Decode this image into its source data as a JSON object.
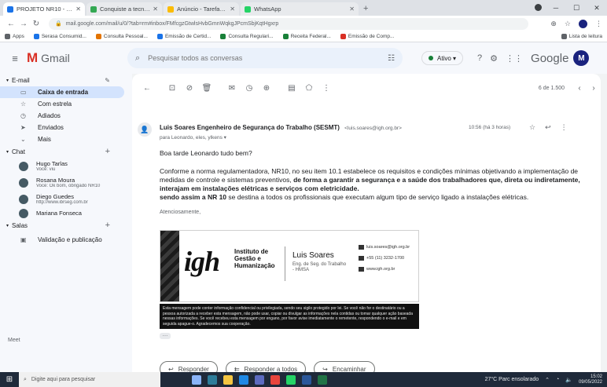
{
  "browser": {
    "tabs": [
      {
        "label": "PROJETO NR10 - MAIO",
        "color": "#1a73e8",
        "active": true
      },
      {
        "label": "Conquiste a tecnica e s...",
        "color": "#34a853",
        "active": false
      },
      {
        "label": "Anúncio - Tarefas Google",
        "color": "#fbbc04",
        "active": false
      },
      {
        "label": "WhatsApp",
        "color": "#25d366",
        "active": false
      }
    ],
    "new_tab": "+",
    "url": "mail.google.com/mail/u/0/?tab=rm#inbox/FMfcgzGtwlsHvbGmnWqkgJPcmSbjKqtHgxrp",
    "bookmarks": [
      {
        "label": "Apps",
        "color": "#5f6368"
      },
      {
        "label": "Serasa Consumid...",
        "color": "#1a73e8"
      },
      {
        "label": "Consulta Pessoal...",
        "color": "#e37400"
      },
      {
        "label": "Emissão de Certid...",
        "color": "#1a73e8"
      },
      {
        "label": "Consulta Regulari...",
        "color": "#188038"
      },
      {
        "label": "Receita Federal...",
        "color": "#188038"
      },
      {
        "label": "Emissão de Comp...",
        "color": "#d93025"
      }
    ],
    "bookmarks_right": "Lista de leitura"
  },
  "gmail": {
    "logo_text": "Gmail",
    "search_placeholder": "Pesquisar todos as conversas",
    "status": "Ativo",
    "google_word": "Google",
    "avatar_letter": "M"
  },
  "sidebar": {
    "mail_header": "E-mail",
    "items": [
      {
        "label": "Caixa de entrada",
        "icon": "▭",
        "active": true
      },
      {
        "label": "Com estrela",
        "icon": "☆",
        "active": false
      },
      {
        "label": "Adiados",
        "icon": "◷",
        "active": false
      },
      {
        "label": "Enviados",
        "icon": "➤",
        "active": false
      },
      {
        "label": "Mais",
        "icon": "⌄",
        "active": false
      }
    ],
    "chat_header": "Chat",
    "chats": [
      {
        "name": "Hugo Tarlas",
        "sub": "Você: viu"
      },
      {
        "name": "Rosana Moura",
        "sub": "Você: Ok bom, obrigado NR10"
      },
      {
        "name": "Diego Guedes",
        "sub": "http://www.ibrseg.com.br"
      },
      {
        "name": "Mariana Fonseca",
        "sub": ""
      }
    ],
    "spaces_header": "Salas",
    "spaces": [
      {
        "label": "Validação e publicação"
      }
    ],
    "more_label": "Meet"
  },
  "message": {
    "pager": "6 de 1.500",
    "sender": "Luis Soares Engenheiro de Segurança do Trabalho (SESMT)",
    "sender_email": "<luis.soares@igh.org.br>",
    "to_line": "para Leonardo, eles, ylkens ▾",
    "date": "10:56 (há 3 horas)",
    "greeting": "Boa tarde Leonardo tudo bem?",
    "para1_normal": "Conforme a norma regulamentadora, NR10, no seu item 10.1 estabelece os requisitos e condições mínimas objetivando a implementação de medidas de controle e sistemas preventivos, ",
    "para1_bold": "de forma a garantir a segurança e a saúde dos trabalhadores que, direta ou indiretamente, interajam em instalações elétricas e serviços com eletricidade.",
    "para2_bold": "sendo assim a NR 10 ",
    "para2_normal": "se destina a todos os profissionais que executam algum tipo de serviço ligado a instalações elétricas.",
    "closing": "Atenciosamente,",
    "signature": {
      "logo": "igh",
      "inst_line1": "Instituto de",
      "inst_line2": "Gestão e",
      "inst_line3": "Humanização",
      "name": "Luis Soares",
      "role": "Eng. de Seg. do Trabalho - HMSA",
      "email": "luis.soares@igh.org.br",
      "phone": "+55 (11) 3232-1700",
      "site": "www.igh.org.br"
    },
    "disclaimer": "Esta mensagem pode conter informação confidencial ou privilegiada, sendo seu sigilo protegido por lei. Se você não for o destinatário ou a pessoa autorizada a receber esta mensagem, não pode usar, copiar ou divulgar as informações nela contidas ou tomar qualquer ação baseada nessas informações. Se você recebeu esta mensagem por engano, por favor avise imediatamente o remetente, respondendo o e-mail e em seguida apague-o. Agradecemos sua cooperação.",
    "reply": "Responder",
    "reply_all": "Responder a todos",
    "forward": "Encaminhar"
  },
  "taskbar": {
    "search_placeholder": "Digite aqui para pesquisar",
    "weather": "27°C Parc ensolarado",
    "time": "15:02",
    "date": "09/05/2022"
  }
}
